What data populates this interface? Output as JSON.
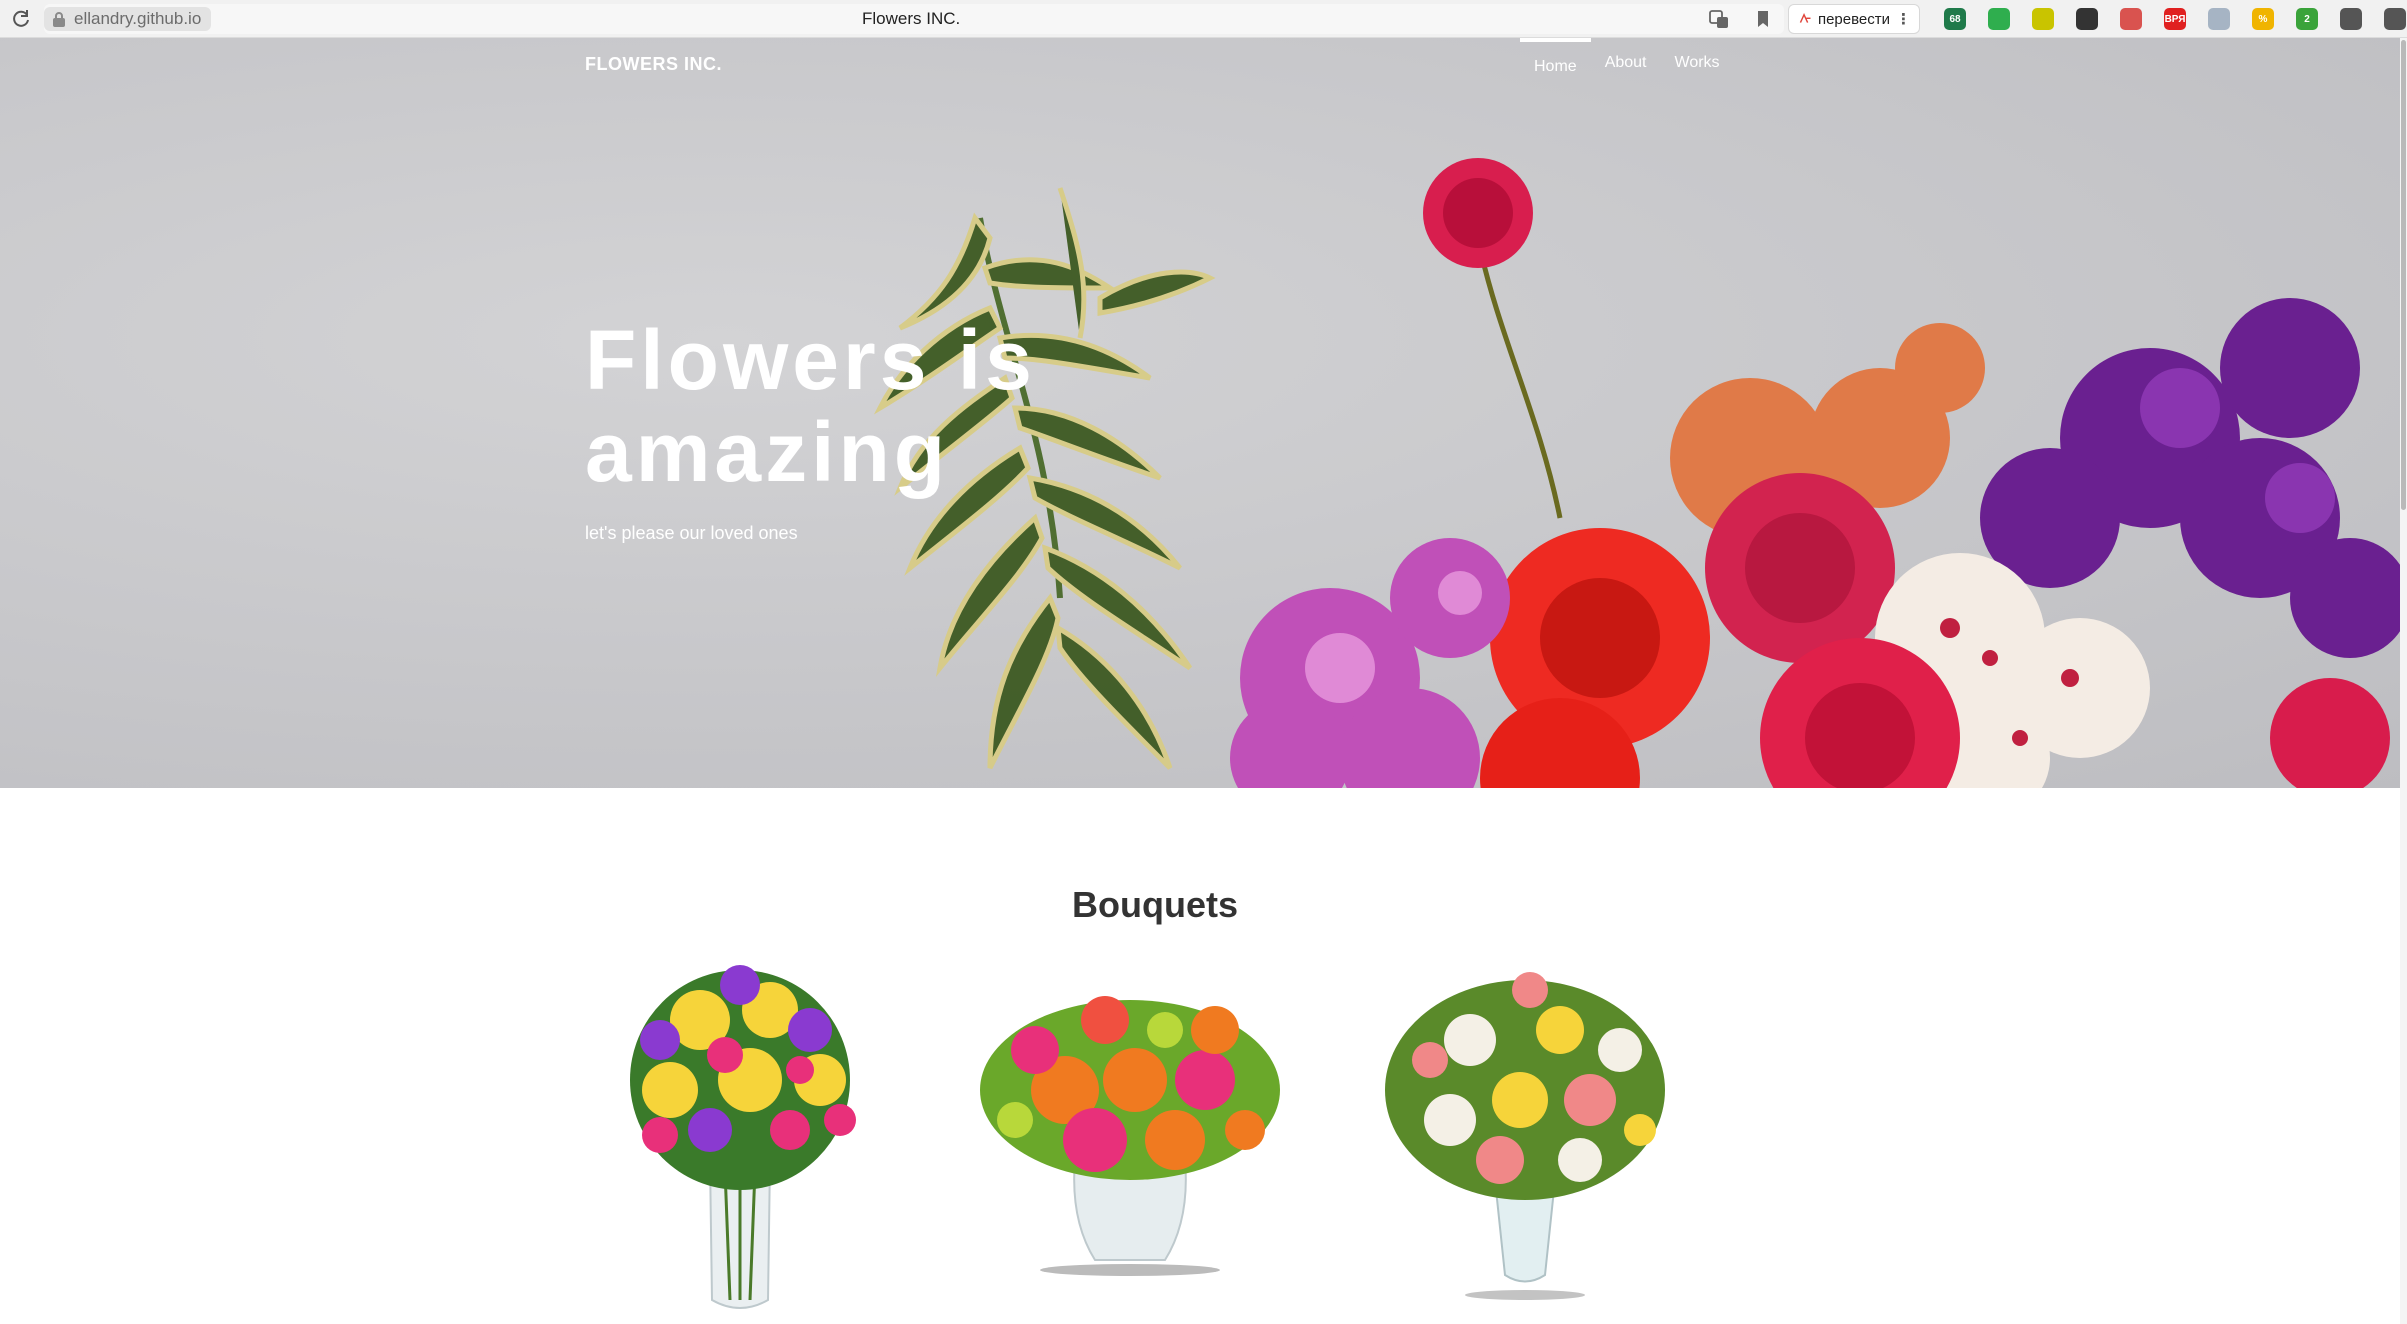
{
  "browser": {
    "url": "ellandry.github.io",
    "tab_title": "Flowers INC.",
    "translate_label": "перевести",
    "extensions": [
      {
        "icon": "ext-grid-icon",
        "color": "#1f7a4a",
        "text": "68"
      },
      {
        "icon": "ext-shield-icon",
        "color": "#2fae4e",
        "text": ""
      },
      {
        "icon": "ext-circle-icon",
        "color": "#c9c400",
        "text": ""
      },
      {
        "icon": "ext-hex-icon",
        "color": "#333333",
        "text": ""
      },
      {
        "icon": "ext-face-icon",
        "color": "#d9534f",
        "text": ""
      },
      {
        "icon": "ext-vpn-icon",
        "color": "#e02020",
        "text": "ВРЯ"
      },
      {
        "icon": "ext-cloud-icon",
        "color": "#a6b4c4",
        "text": ""
      },
      {
        "icon": "ext-percent-icon",
        "color": "#f0b400",
        "text": "%"
      },
      {
        "icon": "ext-badge-icon",
        "color": "#3aa33a",
        "text": "2"
      },
      {
        "icon": "ext-puzzle-icon",
        "color": "#555555",
        "text": ""
      },
      {
        "icon": "download-icon",
        "color": "#555555",
        "text": ""
      }
    ]
  },
  "site": {
    "brand": "FLOWERS INC.",
    "nav": [
      {
        "label": "Home",
        "active": true
      },
      {
        "label": "About",
        "active": false
      },
      {
        "label": "Works",
        "active": false
      }
    ],
    "hero_title": "Flowers is amazing",
    "hero_subtitle": "let's please our loved ones",
    "section_title": "Bouquets"
  },
  "colors": {
    "hero_bg": "#c9c9cc",
    "text_dark": "#333333",
    "white": "#ffffff"
  }
}
